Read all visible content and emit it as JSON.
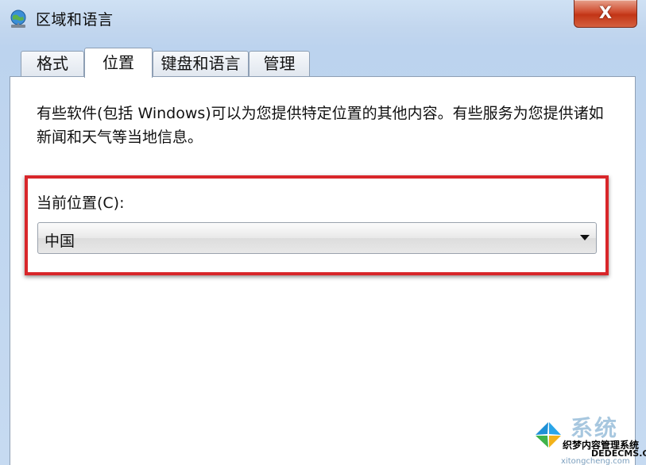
{
  "window": {
    "title": "区域和语言",
    "close_glyph": "X"
  },
  "tabs": [
    {
      "label": "格式"
    },
    {
      "label": "位置"
    },
    {
      "label": "键盘和语言"
    },
    {
      "label": "管理"
    }
  ],
  "location_page": {
    "description": "有些软件(包括 Windows)可以为您提供特定位置的其他内容。有些服务为您提供诸如新闻和天气等当地信息。",
    "current_location_label": "当前位置(C):",
    "current_location_value": "中国"
  },
  "highlight": {
    "color": "#d8262a"
  },
  "watermark": {
    "brand": "系统",
    "line1": "织梦内容管理系统",
    "line2": "DEDECMS.COM",
    "line3": "xitongcheng.com"
  },
  "icons": {
    "app": "globe-network-icon",
    "close": "close-icon",
    "dropdown": "chevron-down-icon",
    "watermark_logo": "windows-logo-icon"
  }
}
